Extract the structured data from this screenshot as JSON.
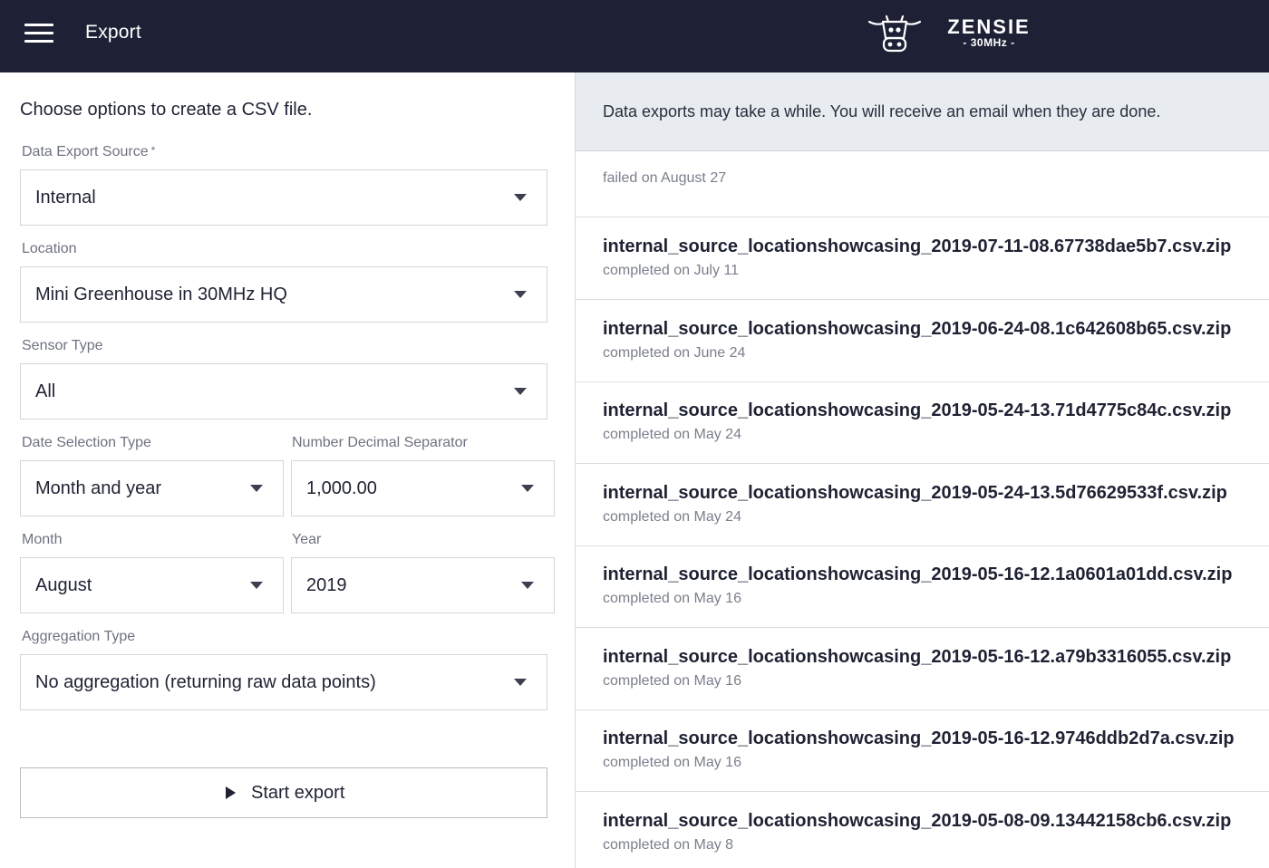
{
  "header": {
    "title": "Export",
    "brand_name": "ZENSIE",
    "brand_sub": "- 30MHz -",
    "menu_icon": "hamburger-icon",
    "logo_icon": "cow-logo-icon",
    "background_color": "#1e2136"
  },
  "form": {
    "intro": "Choose options to create a CSV file.",
    "source": {
      "label": "Data Export Source",
      "required_mark": "*",
      "value": "Internal"
    },
    "location": {
      "label": "Location",
      "value": "Mini Greenhouse in 30MHz HQ"
    },
    "sensor_type": {
      "label": "Sensor Type",
      "value": "All"
    },
    "date_selection_type": {
      "label": "Date Selection Type",
      "value": "Month and year"
    },
    "decimal_separator": {
      "label": "Number Decimal Separator",
      "value": "1,000.00"
    },
    "month": {
      "label": "Month",
      "value": "August"
    },
    "year": {
      "label": "Year",
      "value": "2019"
    },
    "aggregation_type": {
      "label": "Aggregation Type",
      "value": "No aggregation (returning raw data points)"
    },
    "start_button": {
      "label": "Start export",
      "icon": "play-icon"
    }
  },
  "exports": {
    "notice": "Data exports may take a while. You will receive an email when they are done.",
    "failed": {
      "status": "failed on August 27"
    },
    "items": [
      {
        "filename": "internal_source_locationshowcasing_2019-07-11-08.67738dae5b7.csv.zip",
        "status": "completed on July 11"
      },
      {
        "filename": "internal_source_locationshowcasing_2019-06-24-08.1c642608b65.csv.zip",
        "status": "completed on June 24"
      },
      {
        "filename": "internal_source_locationshowcasing_2019-05-24-13.71d4775c84c.csv.zip",
        "status": "completed on May 24"
      },
      {
        "filename": "internal_source_locationshowcasing_2019-05-24-13.5d76629533f.csv.zip",
        "status": "completed on May 24"
      },
      {
        "filename": "internal_source_locationshowcasing_2019-05-16-12.1a0601a01dd.csv.zip",
        "status": "completed on May 16"
      },
      {
        "filename": "internal_source_locationshowcasing_2019-05-16-12.a79b3316055.csv.zip",
        "status": "completed on May 16"
      },
      {
        "filename": "internal_source_locationshowcasing_2019-05-16-12.9746ddb2d7a.csv.zip",
        "status": "completed on May 16"
      },
      {
        "filename": "internal_source_locationshowcasing_2019-05-08-09.13442158cb6.csv.zip",
        "status": "completed on May 8"
      }
    ]
  }
}
